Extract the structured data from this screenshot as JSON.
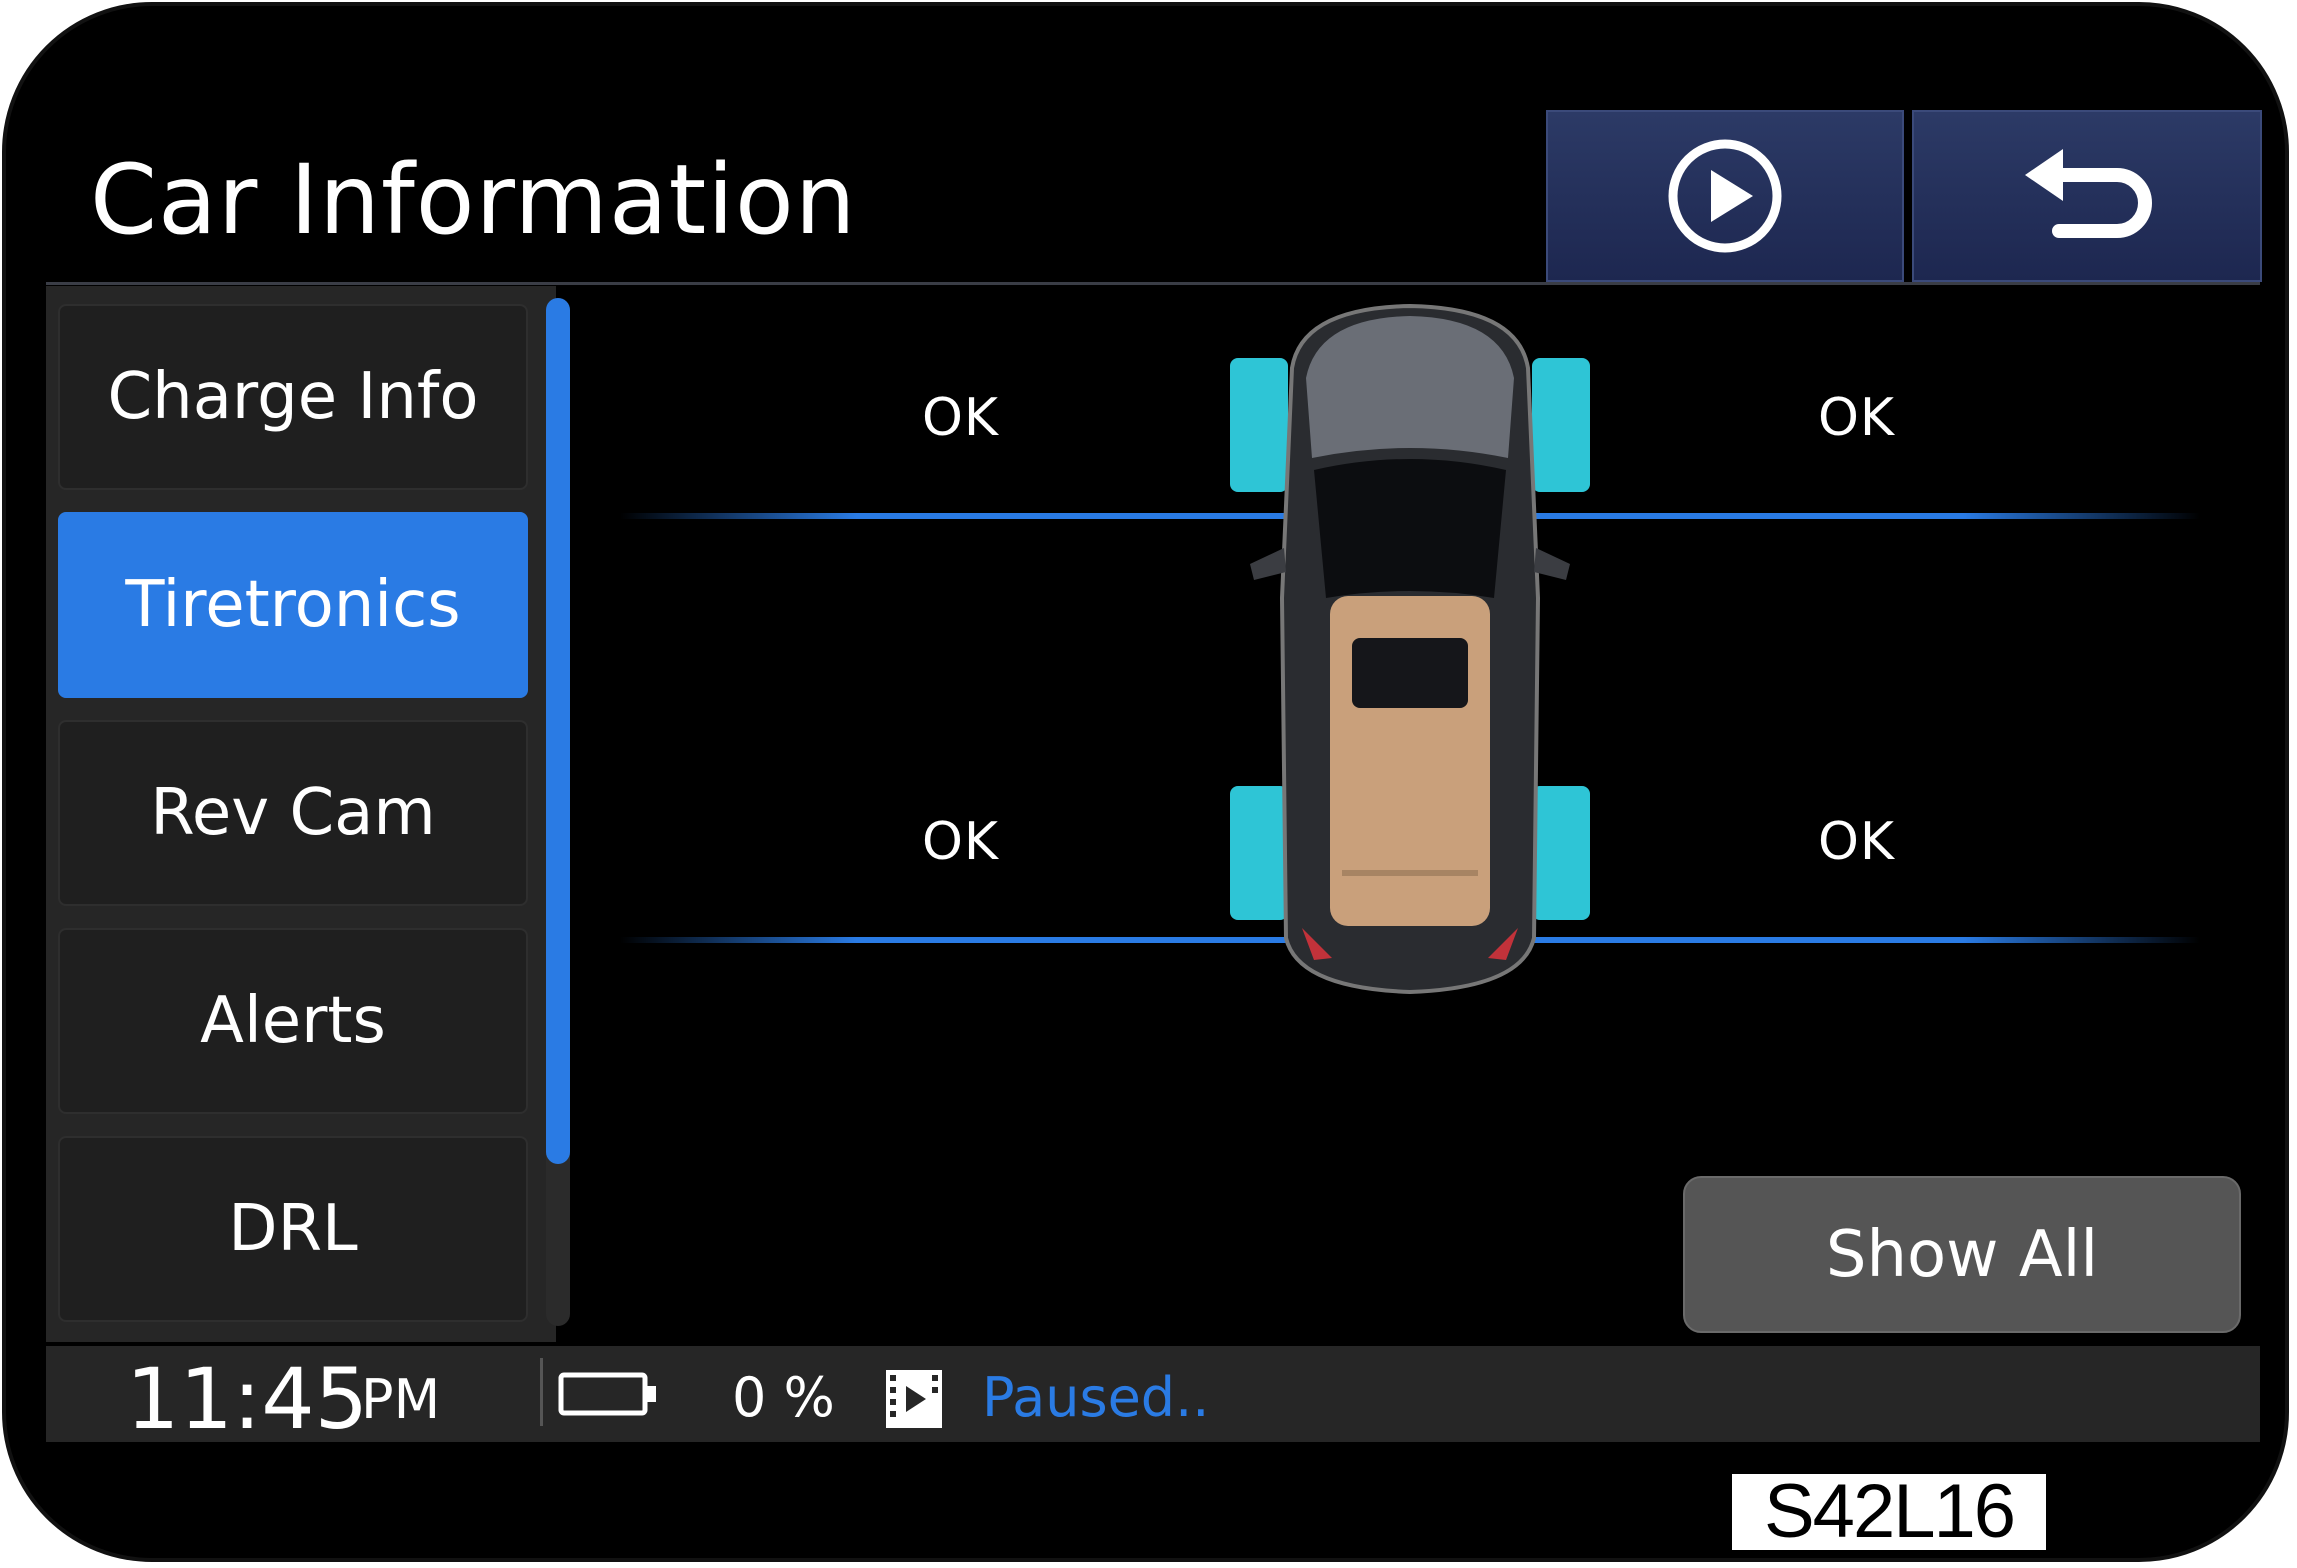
{
  "header": {
    "title": "Car Information"
  },
  "sidebar": {
    "items": [
      {
        "label": "Charge Info"
      },
      {
        "label": "Tiretronics"
      },
      {
        "label": "Rev Cam"
      },
      {
        "label": "Alerts"
      },
      {
        "label": "DRL"
      }
    ],
    "active": "Tiretronics"
  },
  "tires": {
    "front_left": "OK",
    "front_right": "OK",
    "rear_left": "OK",
    "rear_right": "OK"
  },
  "actions": {
    "show_all": "Show All"
  },
  "status_bar": {
    "time": "11:45",
    "ampm": "PM",
    "battery_percent": "0 %",
    "media_status": "Paused.."
  },
  "figure_code": "S42L16",
  "icons": {
    "play": "play-circle-icon",
    "back": "back-arrow-icon",
    "battery": "battery-icon",
    "media": "film-icon"
  },
  "colors": {
    "accent": "#2a7be4",
    "header_button": "#26335e",
    "tire": "#2ec5d6",
    "car_roof": "#c9a07b"
  }
}
